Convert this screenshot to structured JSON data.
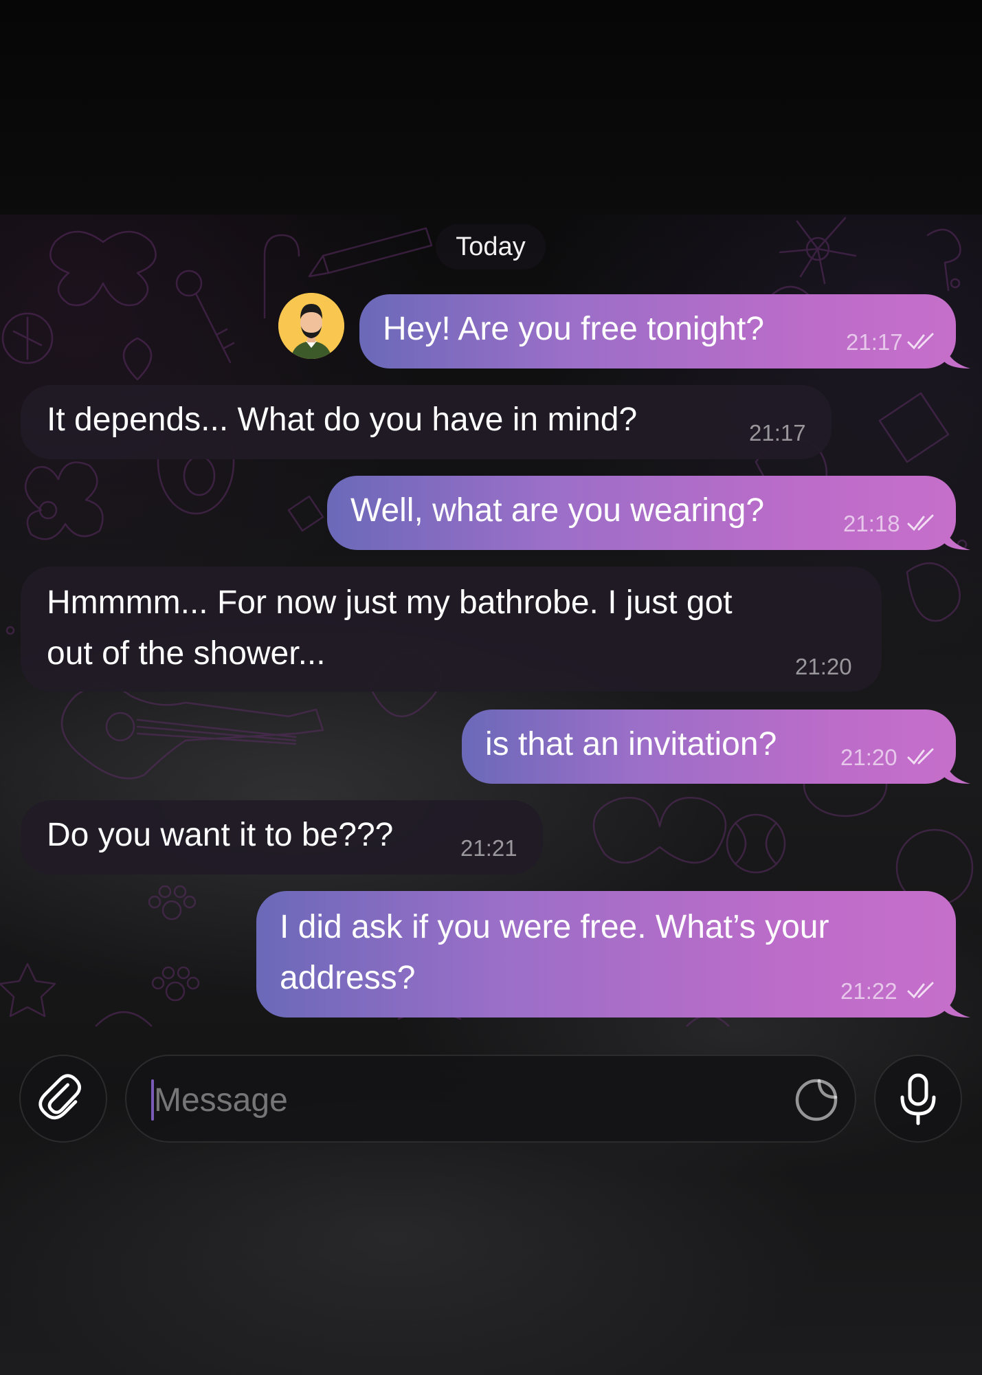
{
  "date_separator": "Today",
  "messages": [
    {
      "direction": "out",
      "text": "Hey! Are you free tonight?",
      "time": "21:17",
      "status": "read"
    },
    {
      "direction": "in",
      "text": "It depends... What do you have in mind?",
      "time": "21:17"
    },
    {
      "direction": "out",
      "text": "Well, what are you wearing?",
      "time": "21:18",
      "status": "read"
    },
    {
      "direction": "in",
      "lines": [
        "Hmmmm... For now just my bathrobe. I just got",
        "out of the shower..."
      ],
      "time": "21:20"
    },
    {
      "direction": "out",
      "text": "is that an invitation?",
      "time": "21:20",
      "status": "read"
    },
    {
      "direction": "in",
      "text": "Do you want it to be???",
      "time": "21:21"
    },
    {
      "direction": "out",
      "lines": [
        "I did ask if you were free. What’s your",
        "address?"
      ],
      "time": "21:22",
      "status": "read"
    }
  ],
  "composer": {
    "placeholder": "Message",
    "attach_icon": "paperclip-icon",
    "sticker_icon": "sticker-icon",
    "mic_icon": "microphone-icon"
  },
  "colors": {
    "outgoing_start": "#6b69b9",
    "outgoing_end": "#c56fca",
    "incoming": "#201b26",
    "avatar_bg": "#f9c74f"
  }
}
